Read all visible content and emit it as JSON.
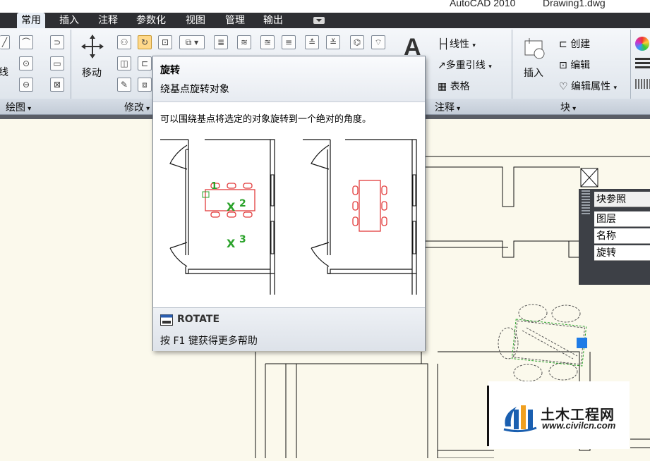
{
  "window": {
    "app_title": "AutoCAD 2010",
    "doc_title": "Drawing1.dwg"
  },
  "tabs": [
    {
      "label": "常用",
      "active": true
    },
    {
      "label": "插入"
    },
    {
      "label": "注释"
    },
    {
      "label": "参数化"
    },
    {
      "label": "视图"
    },
    {
      "label": "管理"
    },
    {
      "label": "输出"
    }
  ],
  "ribbon": {
    "draw_panel": {
      "title": "绘图",
      "partial_label": "线"
    },
    "modify_panel": {
      "title": "修改",
      "move_label": "移动"
    },
    "annotation_panel": {
      "title": "注释",
      "linear_label": "线性",
      "mleader_label": "多重引线",
      "table_label": "表格"
    },
    "block_panel": {
      "title": "块",
      "insert_label": "插入",
      "create_label": "创建",
      "edit_label": "编辑",
      "edit_attr_label": "编辑属性"
    }
  },
  "tooltip": {
    "title": "旋转",
    "subtitle": "绕基点旋转对象",
    "description": "可以围绕基点将选定的对象旋转到一个绝对的角度。",
    "markers": [
      "1",
      "2",
      "3"
    ],
    "marker_x": "X",
    "command": "ROTATE",
    "help": "按 F1 键获得更多帮助"
  },
  "properties": {
    "header": "块参照",
    "rows": [
      "图层",
      "名称",
      "旋转"
    ]
  },
  "watermark": {
    "name": "土木工程网",
    "url": "www.civilcn.com"
  },
  "colors": {
    "ribbon_accent": "#ffd98a",
    "selection_grip": "#1e7be6",
    "markers_green": "#2aa22a",
    "object_red": "#e23c3c"
  }
}
